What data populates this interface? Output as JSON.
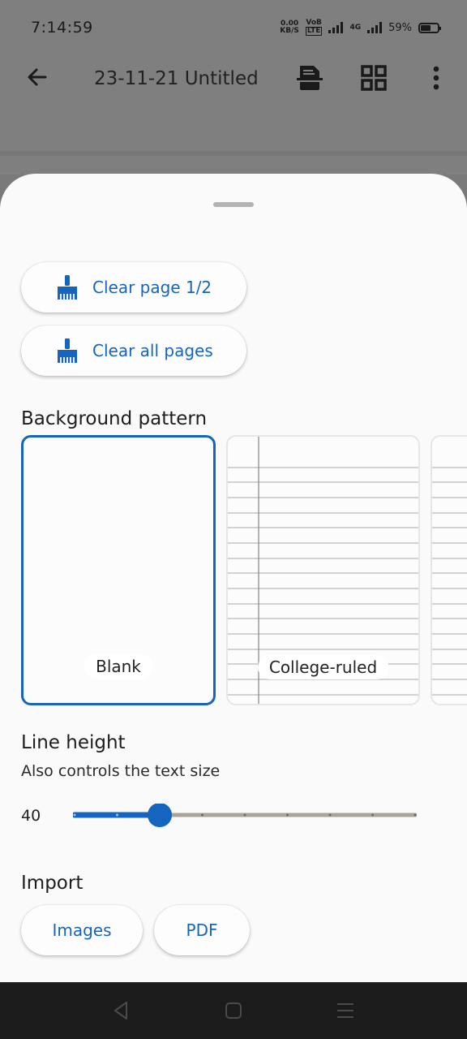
{
  "status_bar": {
    "time": "7:14:59",
    "net_speed_top": "0.00",
    "net_speed_bottom": "KB/S",
    "volte_top": "VoB",
    "volte_bottom": "LTE",
    "network": "4G",
    "battery": "59%",
    "battery_level": 0.59
  },
  "toolbar": {
    "title": "23-11-21 Untitled",
    "back_icon": "arrow-back-icon",
    "icons": [
      "document-save-icon",
      "grid-icon",
      "more-vert-icon"
    ]
  },
  "sheet": {
    "clear_page_label": "Clear page 1/2",
    "clear_all_label": "Clear all pages",
    "background_heading": "Background pattern",
    "patterns": [
      {
        "label": "Blank",
        "selected": true
      },
      {
        "label": "College-ruled",
        "selected": false
      }
    ],
    "line_height_heading": "Line height",
    "line_height_sub": "Also controls the text size",
    "line_height_value": "40",
    "line_height_fraction": 0.25,
    "import_heading": "Import",
    "import_buttons": [
      "Images",
      "PDF"
    ]
  },
  "colors": {
    "accent": "#1565c0",
    "slider_track": "#a9a49a",
    "scrim": "#7f7f7f"
  }
}
